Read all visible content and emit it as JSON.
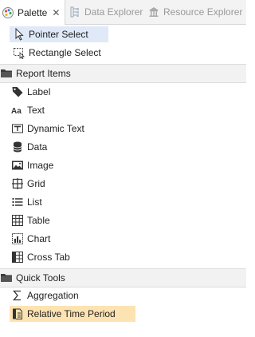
{
  "tabs": [
    {
      "label": "Palette",
      "icon": "palette-icon"
    },
    {
      "label": "Data Explorer",
      "icon": "data-explorer-icon"
    },
    {
      "label": "Resource Explorer",
      "icon": "resource-explorer-icon"
    }
  ],
  "tools": {
    "pointer": {
      "label": "Pointer Select",
      "icon": "pointer-icon"
    },
    "rectangle": {
      "label": "Rectangle Select",
      "icon": "rectangle-select-icon"
    }
  },
  "sections": {
    "report_items": {
      "label": "Report Items",
      "icon": "folder-icon"
    },
    "quick_tools": {
      "label": "Quick Tools",
      "icon": "folder-icon"
    }
  },
  "report_items": [
    {
      "label": "Label",
      "icon": "tag-icon"
    },
    {
      "label": "Text",
      "icon": "text-aa-icon"
    },
    {
      "label": "Dynamic Text",
      "icon": "dynamic-text-icon"
    },
    {
      "label": "Data",
      "icon": "database-icon"
    },
    {
      "label": "Image",
      "icon": "image-icon"
    },
    {
      "label": "Grid",
      "icon": "grid-icon"
    },
    {
      "label": "List",
      "icon": "list-icon"
    },
    {
      "label": "Table",
      "icon": "table-icon"
    },
    {
      "label": "Chart",
      "icon": "chart-icon"
    },
    {
      "label": "Cross Tab",
      "icon": "crosstab-icon"
    }
  ],
  "quick_tools": [
    {
      "label": "Aggregation",
      "icon": "sigma-icon"
    },
    {
      "label": "Relative Time Period",
      "icon": "relative-time-icon"
    }
  ],
  "colors": {
    "selected_bg": "#dfe9f8",
    "highlight_bg": "#fde3b1",
    "section_bg": "#f2f2f2"
  }
}
